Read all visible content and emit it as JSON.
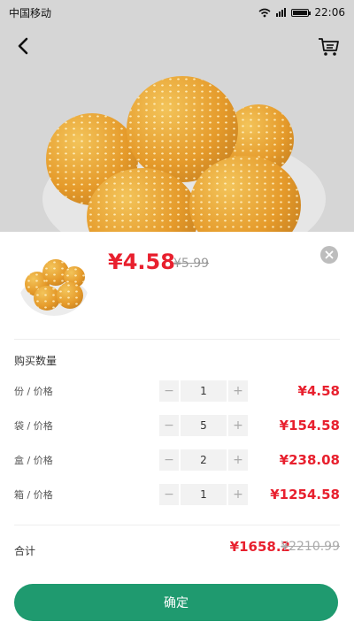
{
  "status_bar": {
    "carrier": "中国移动",
    "time": "22:06"
  },
  "colors": {
    "accent": "#1f9a6f",
    "price": "#e8202e"
  },
  "product": {
    "price": "¥4.58",
    "original_price": "¥5.99"
  },
  "purchase": {
    "section_title": "购买数量",
    "rows": [
      {
        "unit": "份 / 价格",
        "quantity": "1",
        "price": "¥4.58"
      },
      {
        "unit": "袋 / 价格",
        "quantity": "5",
        "price": "¥154.58"
      },
      {
        "unit": "盒 / 价格",
        "quantity": "2",
        "price": "¥238.08"
      },
      {
        "unit": "箱 / 价格",
        "quantity": "1",
        "price": "¥1254.58"
      }
    ],
    "minus_symbol": "−",
    "plus_symbol": "+"
  },
  "total": {
    "label": "合计",
    "price": "¥1658.2",
    "original_price": "¥2210.99"
  },
  "confirm_label": "确定",
  "icons": [
    "back-arrow-icon",
    "cart-icon",
    "close-icon",
    "wifi-icon",
    "signal-icon",
    "battery-icon"
  ]
}
